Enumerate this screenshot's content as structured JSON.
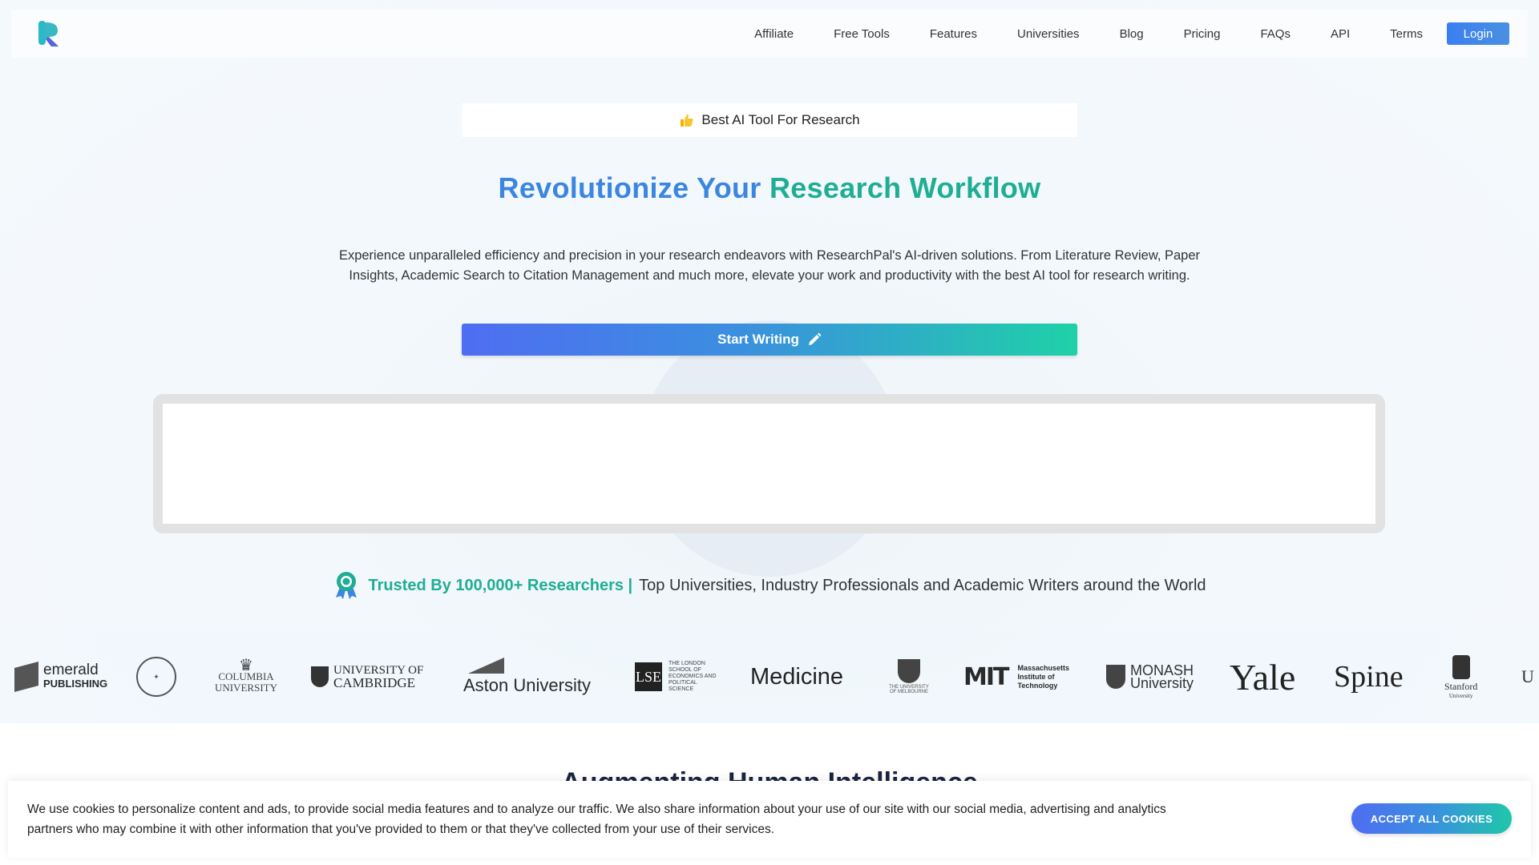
{
  "nav": {
    "links": [
      "Affiliate",
      "Free Tools",
      "Features",
      "Universities",
      "Blog",
      "Pricing",
      "FAQs",
      "API",
      "Terms"
    ],
    "login_label": "Login"
  },
  "hero": {
    "badge": "Best AI Tool For Research",
    "title_part1": "Revolutionize Your",
    "title_part2": "Research Workflow",
    "subtext": "Experience unparalleled efficiency and precision in your research endeavors with ResearchPal's AI-driven solutions. From Literature Review, Paper Insights, Academic Search to Citation Management and much more, elevate your work and productivity with the best AI tool for research writing.",
    "cta_label": "Start Writing"
  },
  "trusted": {
    "strong": "Trusted By 100,000+ Researchers |",
    "rest": "Top Universities, Industry Professionals and Academic Writers around the World"
  },
  "logos": {
    "emerald_line1": "emerald",
    "emerald_line2": "PUBLISHING",
    "columbia_line1": "COLUMBIA",
    "columbia_line2": "UNIVERSITY",
    "cambridge_line1": "UNIVERSITY OF",
    "cambridge_line2": "CAMBRIDGE",
    "aston": "Aston University",
    "lse_mark": "LSE",
    "lse_text": "THE LONDON SCHOOL OF ECONOMICS AND POLITICAL SCIENCE",
    "medicine": "Medicine",
    "melbourne": "THE UNIVERSITY OF MELBOURNE",
    "mit_mark": "MIT",
    "mit_line1": "Massachusetts",
    "mit_line2": "Institute of",
    "mit_line3": "Technology",
    "monash_line1": "MONASH",
    "monash_line2": "University",
    "yale": "Yale",
    "spine": "Spine",
    "stanford_line1": "Stanford",
    "stanford_line2": "University",
    "partial": "U"
  },
  "below": {
    "title": "Augmenting Human Intelligence"
  },
  "cookie": {
    "text": "We use cookies to personalize content and ads, to provide social media features and to analyze our traffic. We also share information about your use of our site with our social media, advertising and analytics partners who may combine it with other information that you've provided to them or that they've collected from your use of their services.",
    "accept_label": "ACCEPT ALL COOKIES"
  },
  "colors": {
    "accent_blue": "#3b86e0",
    "accent_green": "#1fae94",
    "cta_gradient_start": "#4f6df2",
    "cta_gradient_end": "#1fd1a8"
  }
}
